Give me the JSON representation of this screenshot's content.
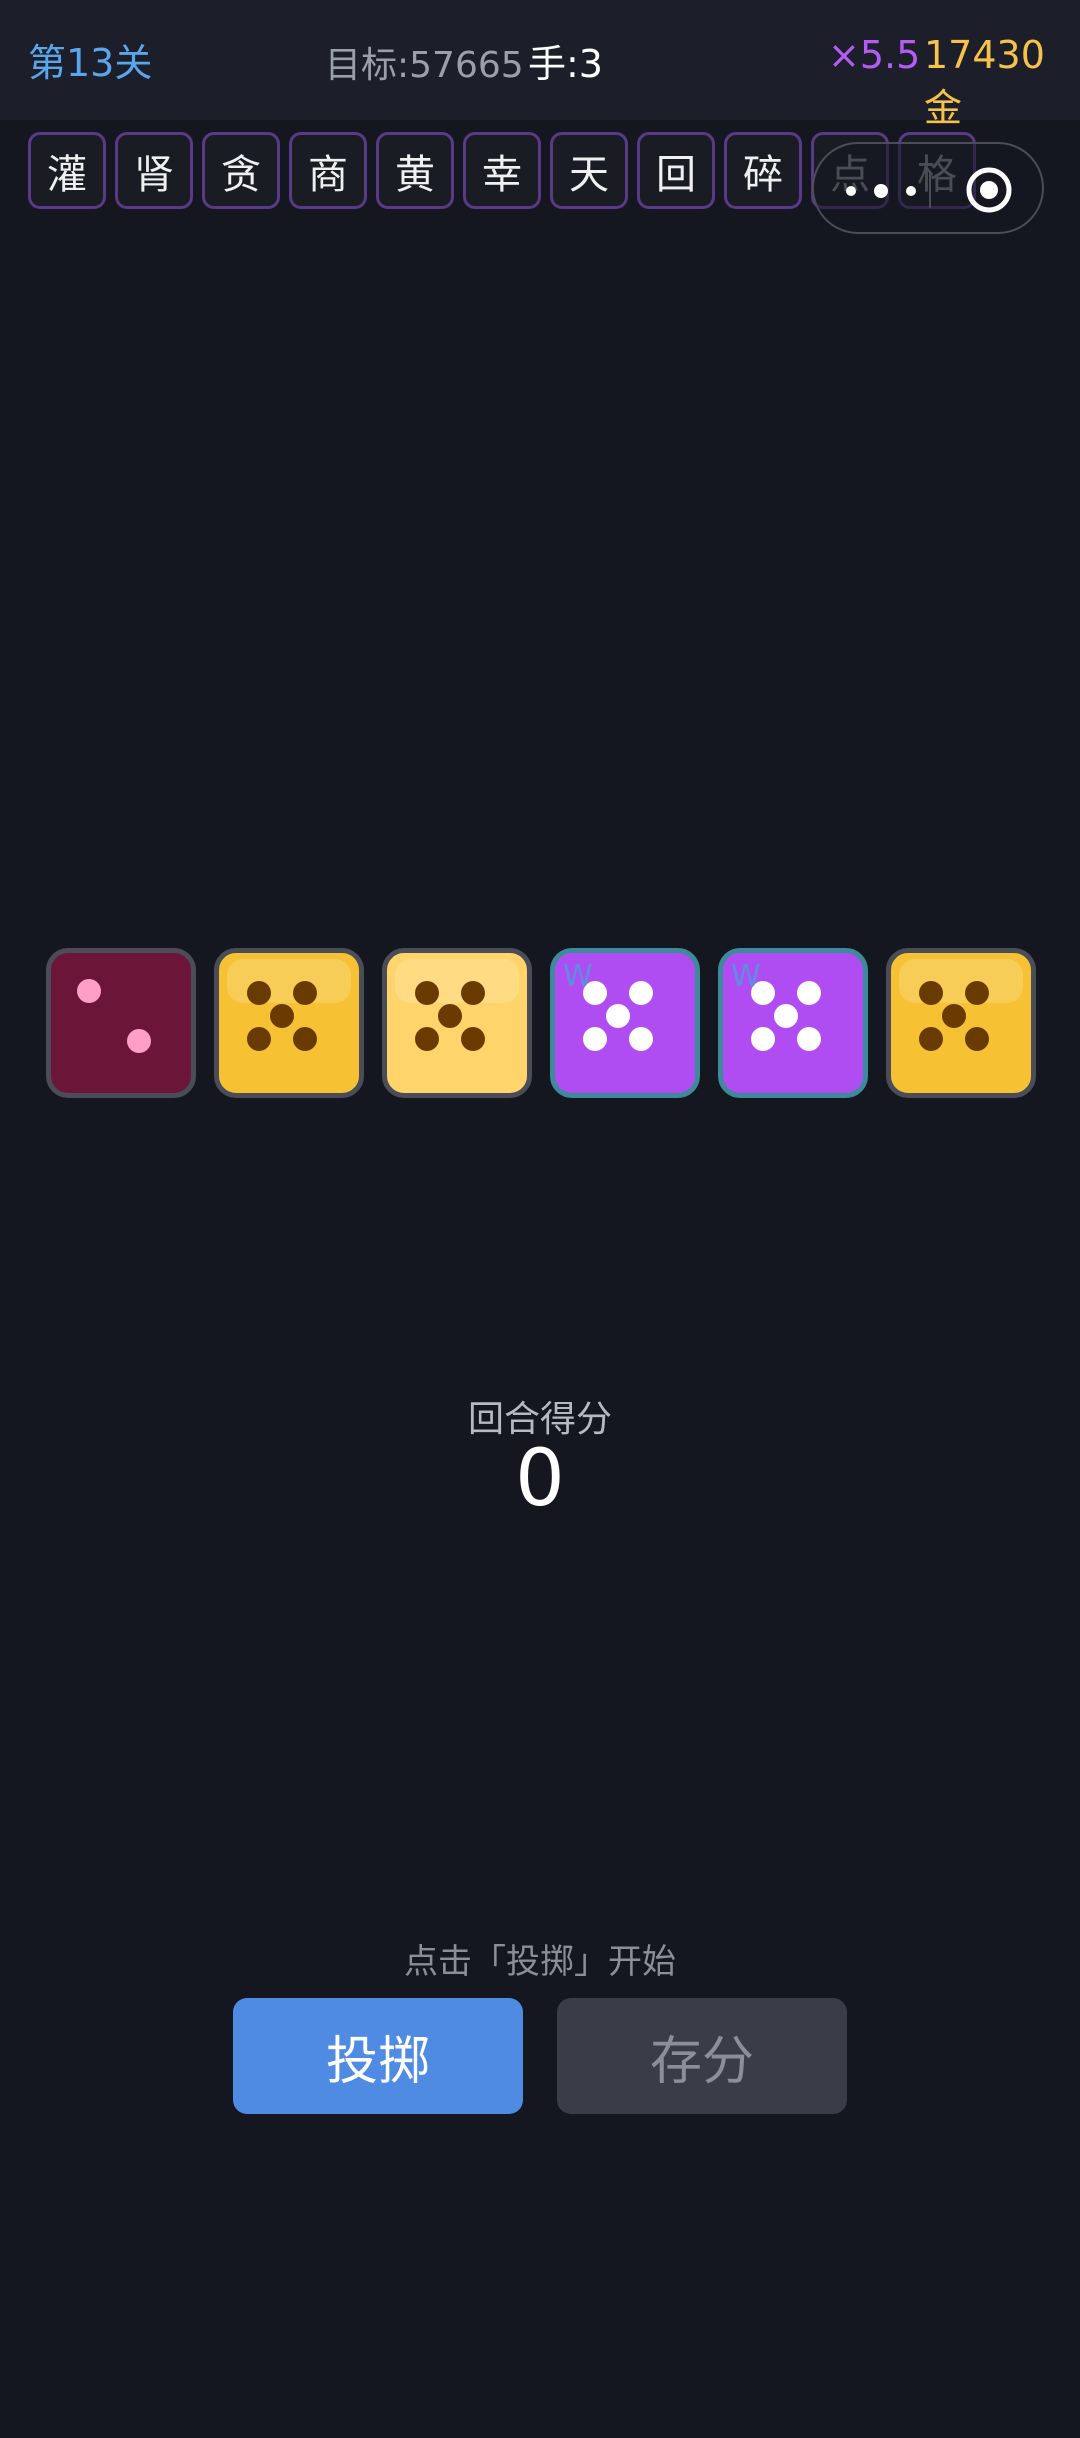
{
  "header": {
    "level": "第13关",
    "target": "目标:57665",
    "hands": "手:3",
    "multiplier": "×5.5",
    "gold": "17430金"
  },
  "relics": [
    "灌",
    "肾",
    "贪",
    "商",
    "黄",
    "幸",
    "天",
    "回",
    "碎",
    "点",
    "格"
  ],
  "capsule": {
    "more_icon": "more-dots-icon",
    "close_icon": "target-circle-icon"
  },
  "dice": [
    {
      "value": 2,
      "color": "crimson",
      "pip_color": "#ff9fc7",
      "badge": ""
    },
    {
      "value": 5,
      "color": "gold",
      "pip_color": "#6a3b00",
      "badge": ""
    },
    {
      "value": 5,
      "color": "lightgold",
      "pip_color": "#6a3b00",
      "badge": ""
    },
    {
      "value": 5,
      "color": "purple",
      "pip_color": "#ffffff",
      "badge": "W"
    },
    {
      "value": 5,
      "color": "purple",
      "pip_color": "#ffffff",
      "badge": "W"
    },
    {
      "value": 5,
      "color": "gold",
      "pip_color": "#6a3b00",
      "badge": ""
    }
  ],
  "round": {
    "label": "回合得分",
    "score": "0"
  },
  "footer": {
    "hint": "点击「投掷」开始",
    "roll_label": "投掷",
    "save_label": "存分"
  },
  "colors": {
    "accent_blue": "#4f8be3",
    "level_blue": "#5aa6ec",
    "mult_purple": "#b45cf3",
    "gold": "#f6c24a",
    "bg": "#14171f"
  }
}
